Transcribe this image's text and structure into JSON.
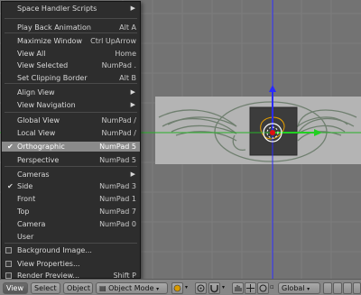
{
  "menu": {
    "items": [
      {
        "label": "Space Handler Scripts",
        "shortcut": "",
        "submenu": true
      },
      {
        "label": "Play Back Animation",
        "shortcut": "Alt A"
      },
      {
        "label": "Maximize Window",
        "shortcut": "Ctrl UpArrow"
      },
      {
        "label": "View All",
        "shortcut": "Home"
      },
      {
        "label": "View Selected",
        "shortcut": "NumPad ."
      },
      {
        "label": "Set Clipping Border",
        "shortcut": "Alt B"
      },
      {
        "label": "Align View",
        "shortcut": "",
        "submenu": true
      },
      {
        "label": "View Navigation",
        "shortcut": "",
        "submenu": true
      },
      {
        "label": "Global View",
        "shortcut": "NumPad /"
      },
      {
        "label": "Local View",
        "shortcut": "NumPad /"
      },
      {
        "label": "Orthographic",
        "shortcut": "NumPad 5",
        "checked": true,
        "highlighted": true
      },
      {
        "label": "Perspective",
        "shortcut": "NumPad 5"
      },
      {
        "label": "Cameras",
        "shortcut": "",
        "submenu": true
      },
      {
        "label": "Side",
        "shortcut": "NumPad 3",
        "checked": true
      },
      {
        "label": "Front",
        "shortcut": "NumPad 1"
      },
      {
        "label": "Top",
        "shortcut": "NumPad 7"
      },
      {
        "label": "Camera",
        "shortcut": "NumPad 0"
      },
      {
        "label": "User",
        "shortcut": ""
      },
      {
        "label": "Background Image...",
        "shortcut": ""
      },
      {
        "label": "View Properties...",
        "shortcut": ""
      },
      {
        "label": "Render Preview...",
        "shortcut": "Shift P"
      }
    ]
  },
  "header": {
    "view": "View",
    "select": "Select",
    "object": "Object",
    "mode": "Object Mode",
    "orientation": "Global"
  },
  "colors": {
    "menu_bg": "#2d2d2d",
    "highlight": "#8a8a8a",
    "viewport_bg": "#737373",
    "axis_blue": "#2020ff",
    "axis_green": "#22c022",
    "origin_red": "#e01010"
  }
}
